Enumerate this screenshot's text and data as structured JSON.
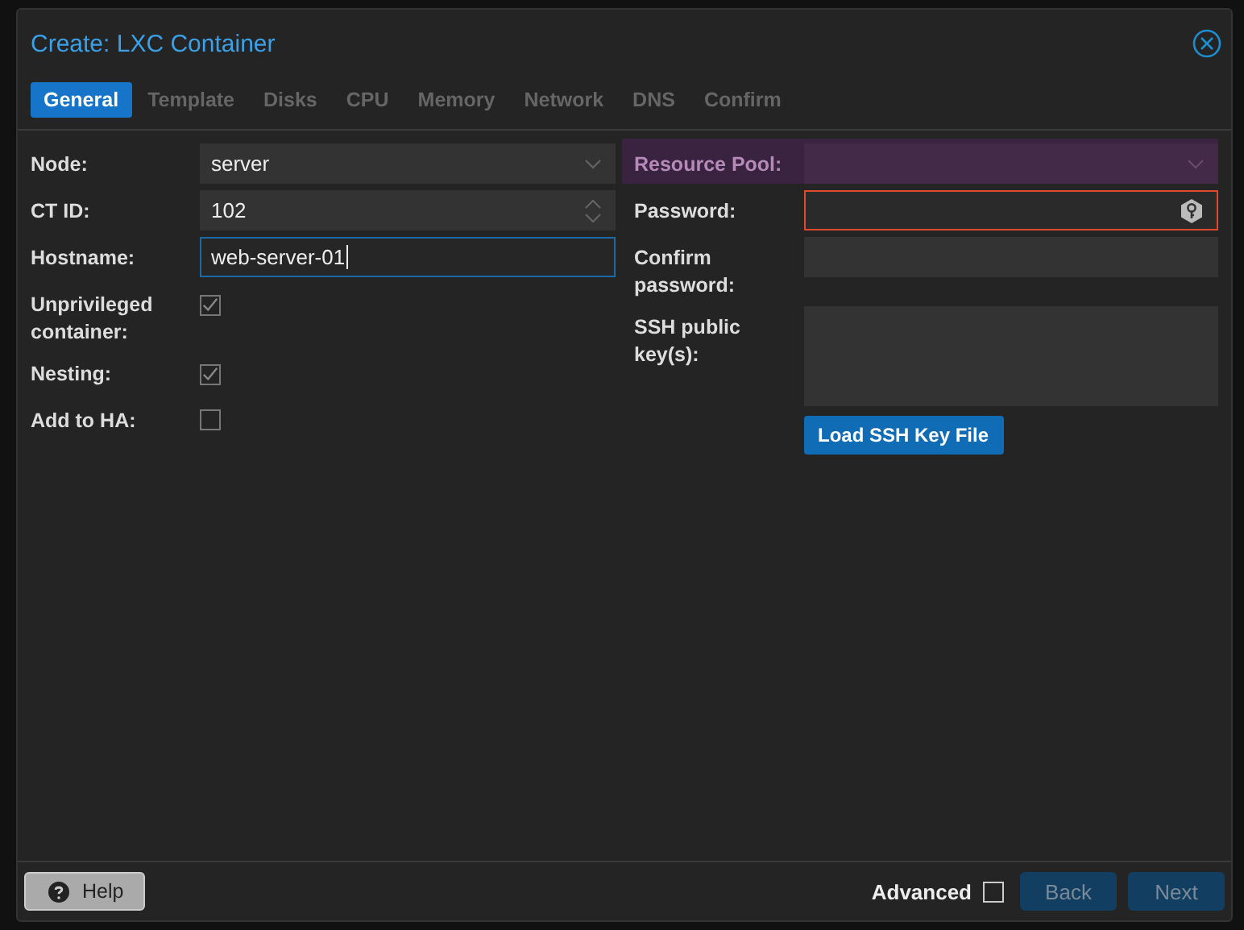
{
  "window": {
    "title": "Create: LXC Container"
  },
  "tabs": [
    {
      "label": "General",
      "selected": true,
      "disabled": false
    },
    {
      "label": "Template",
      "selected": false,
      "disabled": true
    },
    {
      "label": "Disks",
      "selected": false,
      "disabled": true
    },
    {
      "label": "CPU",
      "selected": false,
      "disabled": true
    },
    {
      "label": "Memory",
      "selected": false,
      "disabled": true
    },
    {
      "label": "Network",
      "selected": false,
      "disabled": true
    },
    {
      "label": "DNS",
      "selected": false,
      "disabled": true
    },
    {
      "label": "Confirm",
      "selected": false,
      "disabled": true
    }
  ],
  "left_fields": [
    {
      "kind": "combo",
      "label": "Node:",
      "value": "server",
      "focused": false
    },
    {
      "kind": "spinner",
      "label": "CT ID:",
      "value": "102",
      "focused": false
    },
    {
      "kind": "text",
      "label": "Hostname:",
      "value": "web-server-01",
      "focused": true
    },
    {
      "kind": "checkbox",
      "label": "Unprivileged container:",
      "checked": true
    },
    {
      "kind": "checkbox",
      "label": "Nesting:",
      "checked": true
    },
    {
      "kind": "checkbox",
      "label": "Add to HA:",
      "checked": false
    }
  ],
  "right_fields": [
    {
      "kind": "combo",
      "label": "Resource Pool:",
      "highlighted": true,
      "invalid": false
    },
    {
      "kind": "password",
      "label": "Password:",
      "highlighted": false,
      "invalid": true
    },
    {
      "kind": "password-plain",
      "label": "Confirm password:",
      "highlighted": false,
      "invalid": false
    },
    {
      "kind": "textarea",
      "label": "SSH public key(s):",
      "highlighted": false,
      "invalid": false
    }
  ],
  "load_button": "Load SSH Key File",
  "footer": {
    "help": "Help",
    "advanced": {
      "label": "Advanced",
      "checked": false
    },
    "back": {
      "label": "Back",
      "disabled": true
    },
    "next": {
      "label": "Next",
      "disabled": true
    }
  }
}
